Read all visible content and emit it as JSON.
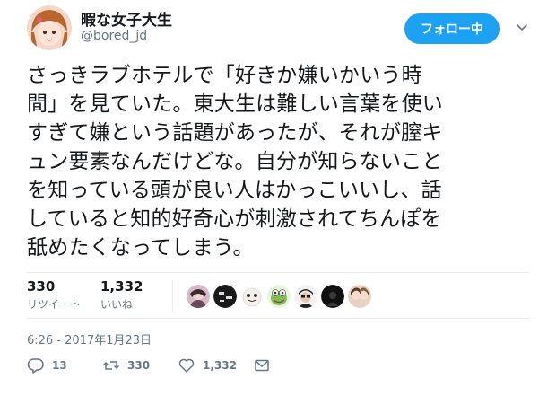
{
  "user": {
    "name": "暇な女子大生",
    "handle": "@bored_jd"
  },
  "follow_button": {
    "label": "フォロー中"
  },
  "tweet": {
    "lines": [
      "さっきラブホテルで「好きか嫌いかいう時",
      "間」を見ていた。東大生は難しい言葉を使い",
      "すぎて嫌という話題があったが、それが膣キ",
      "ュン要素なんだけどな。自分が知らないこと",
      "を知っている頭が良い人はかっこいいし、話",
      "していると知的好奇心が刺激されてちんぽを",
      "舐めたくなってしまう。"
    ]
  },
  "stats": {
    "retweets": {
      "count": "330",
      "label": "リツイート"
    },
    "likes": {
      "count": "1,332",
      "label": "いいね"
    }
  },
  "timestamp": "6:26 - 2017年1月23日",
  "actions": {
    "reply": "13",
    "retweet": "330",
    "like": "1,332"
  },
  "colors": {
    "accent": "#1da1f2",
    "secondary_text": "#657786",
    "divider": "#e6ecf0"
  },
  "icons": [
    "chevron-down-icon",
    "reply-icon",
    "retweet-icon",
    "heart-icon",
    "message-icon"
  ]
}
